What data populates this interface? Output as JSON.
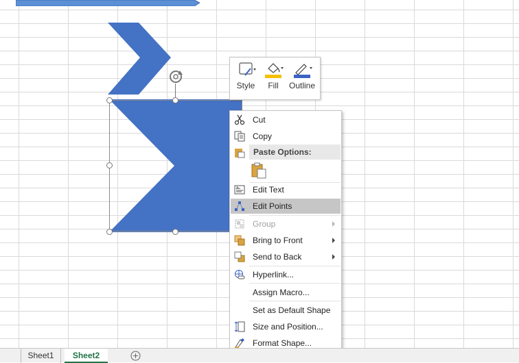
{
  "mini_toolbar": {
    "style_label": "Style",
    "fill_label": "Fill",
    "outline_label": "Outline",
    "fill_color": "#f5c000",
    "outline_color": "#3b63c4"
  },
  "context_menu": {
    "cut": "Cut",
    "copy": "Copy",
    "paste_options": "Paste Options:",
    "edit_text": "Edit Text",
    "edit_points": "Edit Points",
    "group": "Group",
    "bring_to_front": "Bring to Front",
    "send_to_back": "Send to Back",
    "hyperlink": "Hyperlink...",
    "assign_macro": "Assign Macro...",
    "set_default_shape": "Set as Default Shape",
    "size_and_position": "Size and Position...",
    "format_shape": "Format Shape..."
  },
  "sheet_tabs": {
    "sheet1": "Sheet1",
    "sheet2": "Sheet2",
    "active": "Sheet2"
  },
  "colors": {
    "shape_fill": "#4472c4",
    "accent_green": "#217346",
    "highlight": "#c6c6c6"
  }
}
